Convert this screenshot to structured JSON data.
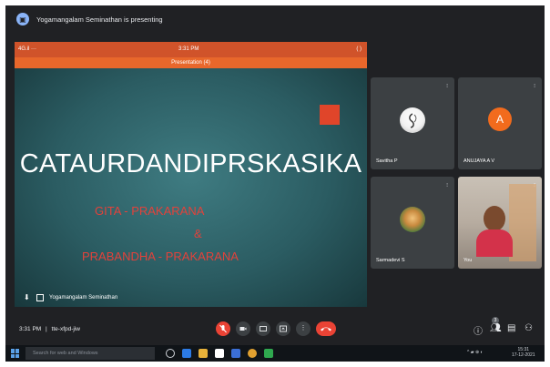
{
  "banner": {
    "presenter_text": "Yogamangalam Seminathan is presenting"
  },
  "presentation": {
    "phone_status": {
      "left": "4G.il ···",
      "time": "3:31 PM",
      "right": "( )"
    },
    "title_bar": "Presentation (4)",
    "slide": {
      "title": "CATAURDANDIPRSKASIKA",
      "line1": "GITA - PRAKARANA",
      "line2": "&",
      "line3": "PRABANDHA - PRAKARANA"
    },
    "presenter_name": "Yogamangalam Seminathan"
  },
  "participants": [
    {
      "name": "Savitha P",
      "avatar": "photo"
    },
    {
      "name": "ANUJAYA A V",
      "avatar": "A"
    },
    {
      "name": "Sarmadevi S",
      "avatar": "photo"
    },
    {
      "name": "You",
      "avatar": "video"
    }
  ],
  "meeting": {
    "time": "3:31 PM",
    "code": "tte-xfpd-jiw"
  },
  "controls": {
    "mic_icon": "mic-off-icon",
    "end_call_icon": "call-end-icon",
    "people_count": "3"
  },
  "taskbar": {
    "search_placeholder": "Search for web and Windows",
    "tray_time": "15:31",
    "tray_date": "17-12-2021"
  },
  "colors": {
    "accent_orange": "#e8672b",
    "end_call_red": "#ea4335",
    "meet_bg": "#202124"
  }
}
